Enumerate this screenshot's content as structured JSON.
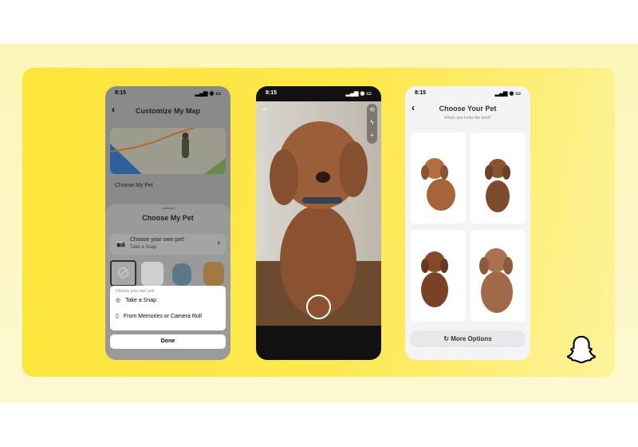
{
  "status_time": "8:15",
  "phone1": {
    "title": "Customize My Map",
    "choose_row": "Choose My Pet",
    "sheet_title": "Choose My Pet",
    "own_pet_title": "Choose your own pet!",
    "own_pet_sub": "Take a Snap",
    "popup_header": "Choose your own pet!",
    "popup_items": [
      "Take a Snap",
      "From Memories or Camera Roll"
    ],
    "done_label": "Done"
  },
  "phone3": {
    "title": "Choose Your Pet",
    "subtitle": "Which one looks the best?",
    "more_label": "More Options"
  },
  "colors": {
    "brand_yellow": "#FDE53A",
    "dog_brown": "#9a5a35"
  }
}
